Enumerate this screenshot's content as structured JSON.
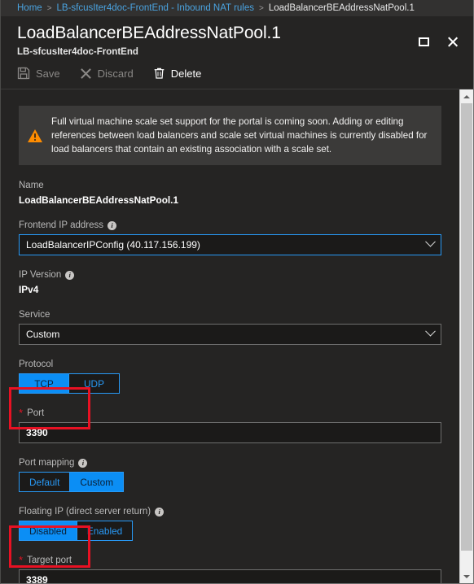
{
  "breadcrumb": {
    "items": [
      {
        "label": "Home",
        "current": false
      },
      {
        "label": "LB-sfcusIter4doc-FrontEnd - Inbound NAT rules",
        "current": false
      },
      {
        "label": "LoadBalancerBEAddressNatPool.1",
        "current": true
      }
    ],
    "separator": ">"
  },
  "header": {
    "title": "LoadBalancerBEAddressNatPool.1",
    "subtitle": "LB-sfcusIter4doc-FrontEnd",
    "maximize_icon": "maximize-icon",
    "close_icon": "close-icon"
  },
  "toolbar": {
    "save_label": "Save",
    "discard_label": "Discard",
    "delete_label": "Delete",
    "save_enabled": false,
    "discard_enabled": false,
    "delete_enabled": true
  },
  "banner": {
    "icon": "warning-icon",
    "text": "Full virtual machine scale set support for the portal is coming soon. Adding or editing references between load balancers and scale set virtual machines is currently disabled for load balancers that contain an existing association with a scale set."
  },
  "form": {
    "name": {
      "label": "Name",
      "value": "LoadBalancerBEAddressNatPool.1"
    },
    "frontend_ip": {
      "label": "Frontend IP address",
      "info_icon": "info-icon",
      "value": "LoadBalancerIPConfig (40.117.156.199)",
      "chevron": "chevron-down-icon"
    },
    "ip_version": {
      "label": "IP Version",
      "info_icon": "info-icon",
      "value": "IPv4"
    },
    "service": {
      "label": "Service",
      "value": "Custom",
      "chevron": "chevron-down-icon"
    },
    "protocol": {
      "label": "Protocol",
      "options": [
        {
          "label": "TCP",
          "selected": true
        },
        {
          "label": "UDP",
          "selected": false
        }
      ]
    },
    "port": {
      "label": "Port",
      "required": true,
      "required_mark": "*",
      "value": "3390",
      "highlighted": true
    },
    "port_mapping": {
      "label": "Port mapping",
      "info_icon": "info-icon",
      "options": [
        {
          "label": "Default",
          "selected": false
        },
        {
          "label": "Custom",
          "selected": true
        }
      ]
    },
    "floating_ip": {
      "label": "Floating IP (direct server return)",
      "info_icon": "info-icon",
      "options": [
        {
          "label": "Disabled",
          "selected": true
        },
        {
          "label": "Enabled",
          "selected": false
        }
      ]
    },
    "target_port": {
      "label": "Target port",
      "required": true,
      "required_mark": "*",
      "value": "3389",
      "highlighted": true
    }
  },
  "scrollbar": {
    "up_arrow": "scroll-up-arrow",
    "down_arrow": "scroll-down-arrow",
    "thumb": "scroll-thumb"
  },
  "colors": {
    "accent": "#0b8ef5",
    "link": "#4aa3e0",
    "warning": "#ff8c00",
    "required": "#e81123",
    "annotation": "#e81123",
    "panel_bg": "#252423",
    "field_bg": "#1b1a19"
  }
}
